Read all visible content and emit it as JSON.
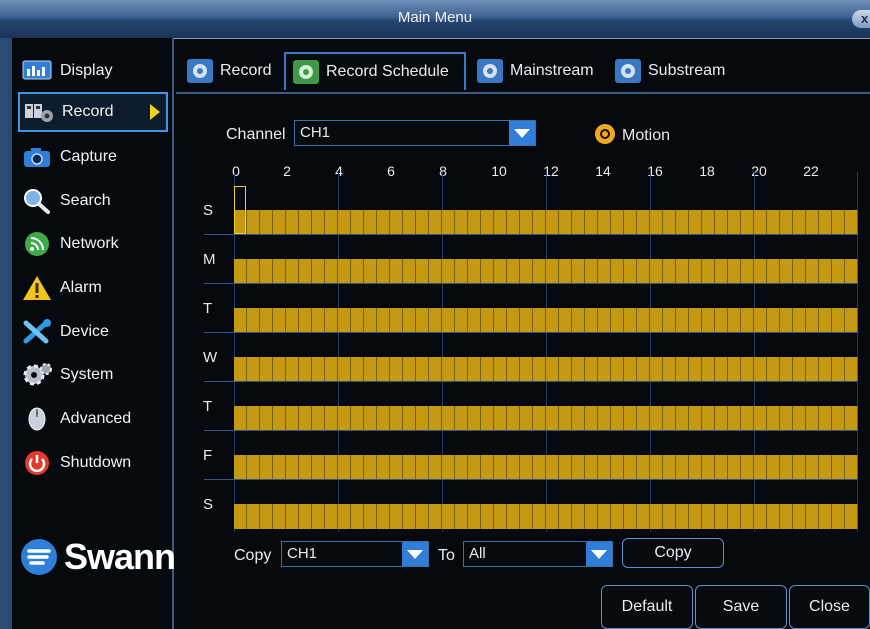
{
  "window": {
    "title": "Main Menu",
    "close_symbol": "x"
  },
  "sidebar": {
    "items": [
      {
        "label": "Display",
        "icon": "display-icon",
        "active": false
      },
      {
        "label": "Record",
        "icon": "record-icon",
        "active": true
      },
      {
        "label": "Capture",
        "icon": "camera-icon",
        "active": false
      },
      {
        "label": "Search",
        "icon": "search-icon",
        "active": false
      },
      {
        "label": "Network",
        "icon": "network-icon",
        "active": false
      },
      {
        "label": "Alarm",
        "icon": "alarm-icon",
        "active": false
      },
      {
        "label": "Device",
        "icon": "device-icon",
        "active": false
      },
      {
        "label": "System",
        "icon": "gear-icon",
        "active": false
      },
      {
        "label": "Advanced",
        "icon": "mouse-icon",
        "active": false
      },
      {
        "label": "Shutdown",
        "icon": "power-icon",
        "active": false
      }
    ],
    "logo_text": "Swann"
  },
  "tabs": [
    {
      "label": "Record",
      "active": false
    },
    {
      "label": "Record Schedule",
      "active": true
    },
    {
      "label": "Mainstream",
      "active": false
    },
    {
      "label": "Substream",
      "active": false
    }
  ],
  "schedule": {
    "channel_label": "Channel",
    "channel_value": "CH1",
    "mode_label": "Motion",
    "hour_labels": [
      "0",
      "2",
      "4",
      "6",
      "8",
      "10",
      "12",
      "14",
      "16",
      "18",
      "20",
      "22"
    ],
    "days": [
      "S",
      "M",
      "T",
      "W",
      "T",
      "F",
      "S"
    ],
    "motion_color": "#c39a12",
    "copy_label": "Copy",
    "copy_from": "CH1",
    "to_label": "To",
    "copy_to": "All",
    "copy_button": "Copy"
  },
  "footer": {
    "default_button": "Default",
    "save_button": "Save",
    "close_button": "Close"
  },
  "colors": {
    "accent": "#3f95e6",
    "title_bar": "#3f6190",
    "highlight": "#f2d21d"
  }
}
